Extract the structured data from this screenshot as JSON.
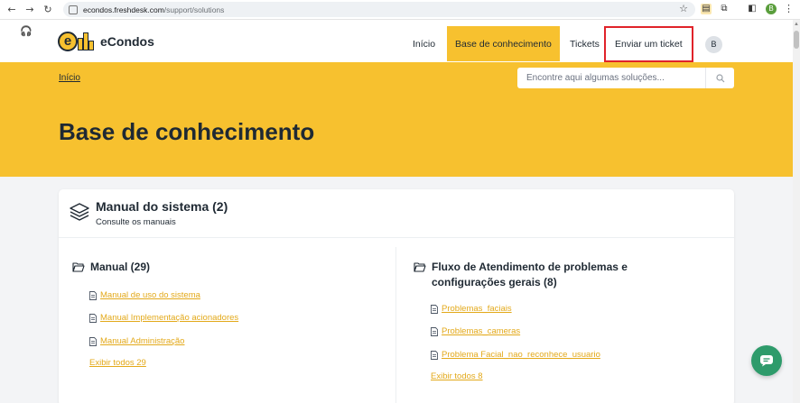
{
  "browser": {
    "url_host": "econdos.freshdesk.com",
    "url_path": "/support/solutions",
    "profile_initial": "B"
  },
  "brand": {
    "name": "eCondos",
    "color": "#f7c12f"
  },
  "nav": {
    "inicio": "Início",
    "kb": "Base de conhecimento",
    "tickets": "Tickets",
    "enviar": "Enviar um ticket",
    "avatar_initial": "B"
  },
  "hero": {
    "breadcrumb": "Início",
    "search_placeholder": "Encontre aqui algumas soluções...",
    "title": "Base de conhecimento"
  },
  "category": {
    "title": "Manual do sistema (2)",
    "subtitle": "Consulte os manuais",
    "folders": [
      {
        "title": "Manual (29)",
        "articles": [
          "Manual de uso do sistema",
          "Manual Implementação acionadores",
          "Manual Administração"
        ],
        "view_all": "Exibir todos 29"
      },
      {
        "title_line1": "Fluxo de Atendimento de problemas e",
        "title_line2": "configurações gerais (8)",
        "articles": [
          "Problemas_faciais",
          "Problemas_cameras",
          "Problema Facial_nao_reconhece_usuario"
        ],
        "view_all": "Exibir todos 8"
      }
    ]
  }
}
